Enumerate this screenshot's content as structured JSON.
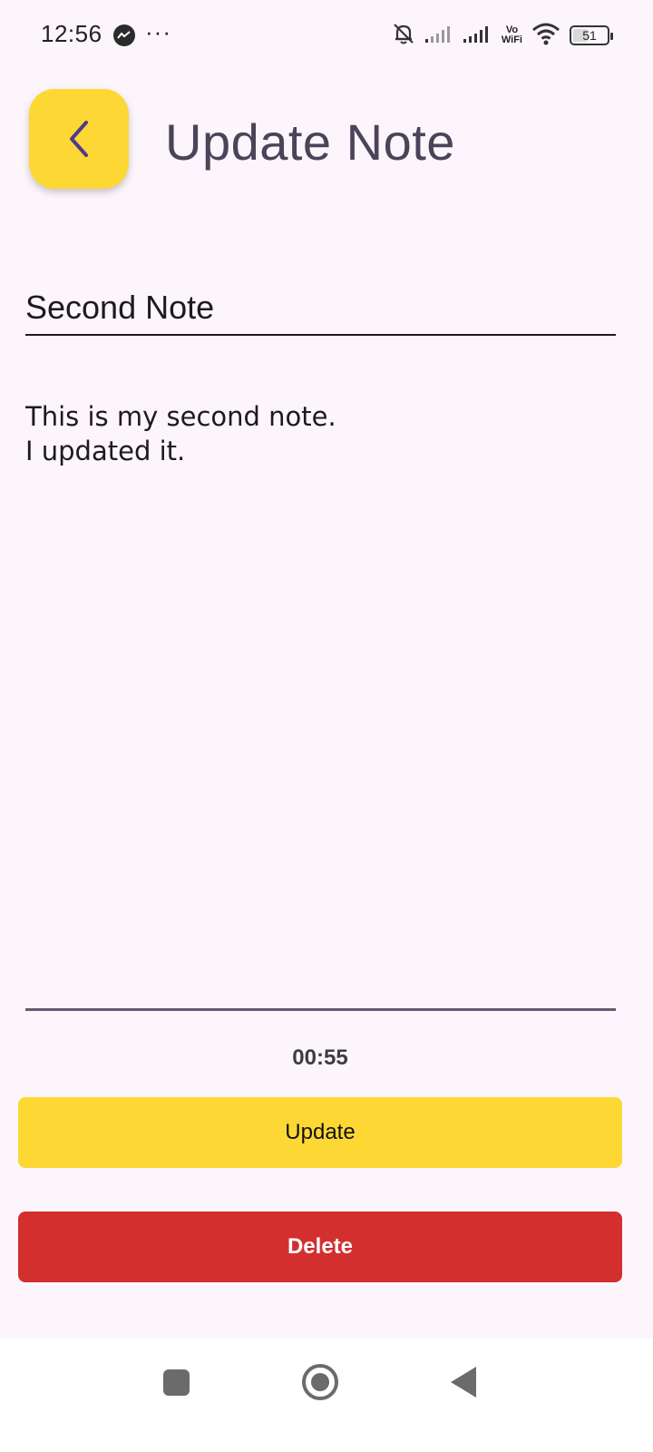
{
  "status_bar": {
    "time": "12:56",
    "dots": "···",
    "vowifi_top": "Vo",
    "vowifi_bottom": "WiFi",
    "battery": "51",
    "battery_level": 0.51
  },
  "header": {
    "title": "Update Note",
    "back_icon": "chevron-left-icon"
  },
  "note": {
    "title": "Second Note",
    "body": "This is my second note.\nI updated it.",
    "timestamp": "00:55"
  },
  "actions": {
    "update_label": "Update",
    "delete_label": "Delete"
  },
  "colors": {
    "accent": "#fdd835",
    "danger": "#d32f2f",
    "background": "#fcf5fc",
    "title_text": "#4a4458",
    "back_chevron": "#4f3a8c"
  },
  "nav": {
    "recent_icon": "square-icon",
    "home_icon": "circle-icon",
    "back_icon": "triangle-back-icon"
  }
}
